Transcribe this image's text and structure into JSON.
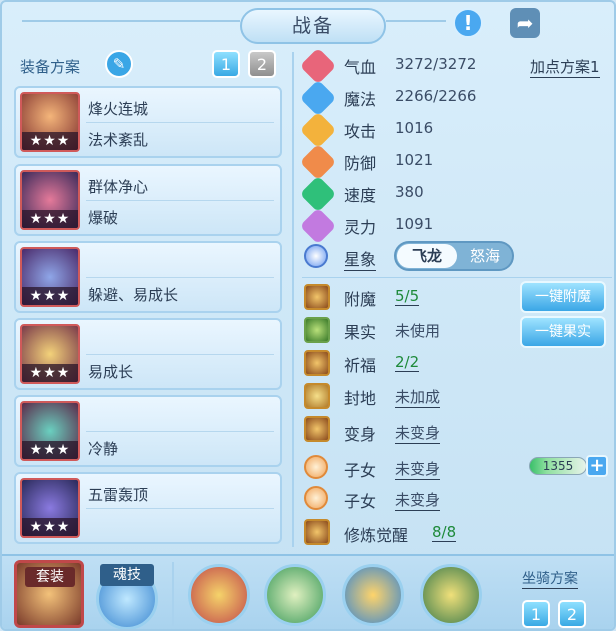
{
  "title": "战备",
  "equip_plan": {
    "label": "装备方案",
    "buttons": [
      "1",
      "2"
    ],
    "items": [
      {
        "line1": "烽火连城",
        "line2": "法术紊乱",
        "stars": "★★★"
      },
      {
        "line1": "群体净心",
        "line2": "爆破",
        "stars": "★★★"
      },
      {
        "line1": "",
        "line2": "躲避、易成长",
        "stars": "★★★"
      },
      {
        "line1": "",
        "line2": "易成长",
        "stars": "★★★"
      },
      {
        "line1": "",
        "line2": "冷静",
        "stars": "★★★"
      },
      {
        "line1": "五雷轰顶",
        "line2": "",
        "stars": "★★★"
      }
    ]
  },
  "stats": [
    {
      "label": "气血",
      "value": "3272/3272",
      "color": "#e8657a",
      "icon": "heart-icon"
    },
    {
      "label": "魔法",
      "value": "2266/2266",
      "color": "#4aa8f0",
      "icon": "mana-icon"
    },
    {
      "label": "攻击",
      "value": "1016",
      "color": "#f3b23c",
      "icon": "sword-icon"
    },
    {
      "label": "防御",
      "value": "1021",
      "color": "#f08b4a",
      "icon": "shield-icon"
    },
    {
      "label": "速度",
      "value": "380",
      "color": "#2fc07a",
      "icon": "speed-icon"
    },
    {
      "label": "灵力",
      "value": "1091",
      "color": "#c27ae0",
      "icon": "spirit-icon"
    }
  ],
  "point_plan": "加点方案1",
  "xingxiang": {
    "label": "星象",
    "options": [
      "飞龙",
      "怒海"
    ],
    "selected": "飞龙"
  },
  "buffs": [
    {
      "label": "附魔",
      "value": "5/5",
      "green": true,
      "button": "一键附魔"
    },
    {
      "label": "果实",
      "value": "未使用",
      "green": false,
      "button": "一键果实"
    },
    {
      "label": "祈福",
      "value": "2/2",
      "green": true
    },
    {
      "label": "封地",
      "value": "未加成",
      "green": false
    },
    {
      "label": "变身",
      "value": "未变身",
      "green": false
    },
    {
      "label": "子女",
      "value": "未变身",
      "green": false
    },
    {
      "label": "子女",
      "value": "未变身",
      "green": false
    },
    {
      "label": "修炼觉醒",
      "value": "8/8",
      "green": true
    }
  ],
  "exp_value": "1355",
  "bottom": {
    "suit_label": "套装",
    "soul_label": "魂技",
    "mount_label": "坐骑方案",
    "mount_buttons": [
      "1",
      "2"
    ]
  }
}
